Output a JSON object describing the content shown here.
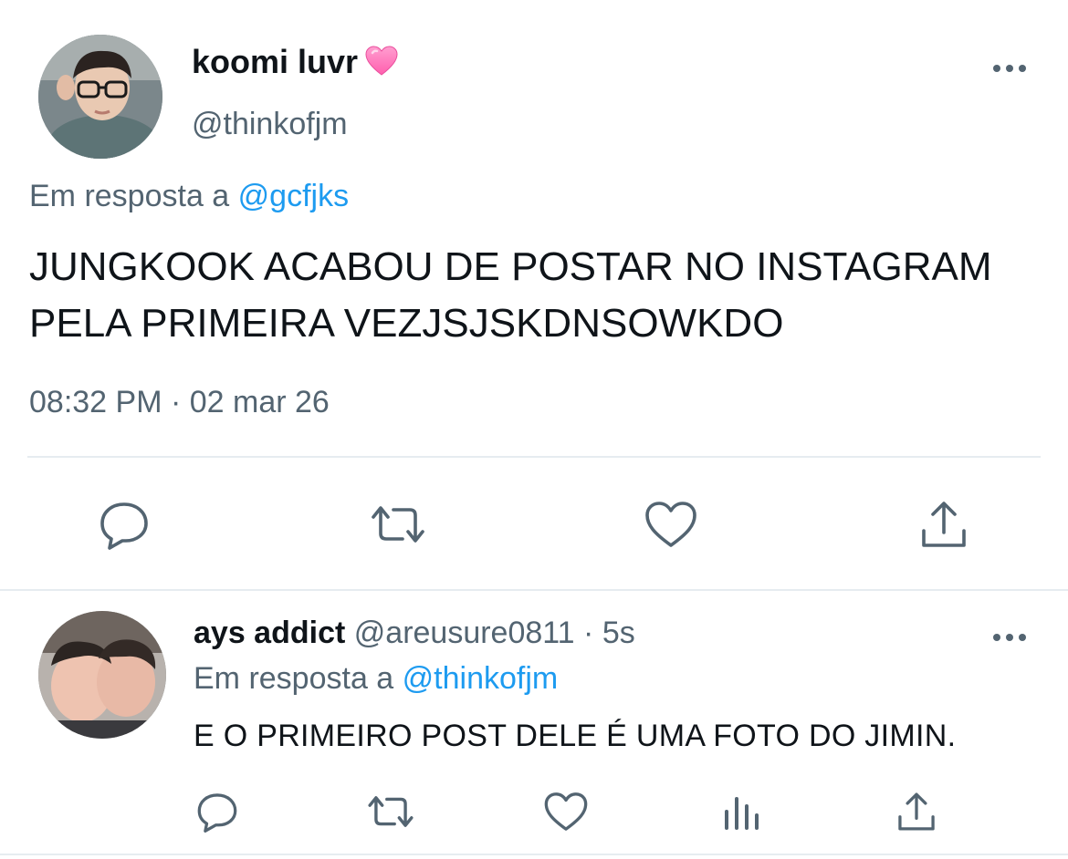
{
  "main_tweet": {
    "display_name": "koomi luvr",
    "name_emoji": "💗",
    "handle": "@thinkofjm",
    "reply_prefix": "Em resposta a",
    "reply_to": "@gcfjks",
    "text": "JUNGKOOK ACABOU DE POSTAR NO INSTAGRAM PELA PRIMEIRA VEZJSJSKDNSOWKDO",
    "timestamp": "08:32 PM · 02 mar 26",
    "actions": [
      "reply-icon",
      "retweet-icon",
      "like-icon",
      "share-icon"
    ]
  },
  "reply_tweet": {
    "display_name": "ays addict",
    "handle": "@areusure0811",
    "separator": "·",
    "age": "5s",
    "reply_prefix": "Em resposta a",
    "reply_to": "@thinkofjm",
    "text": "E O PRIMEIRO POST DELE É UMA FOTO DO JIMIN.",
    "actions": [
      "reply-icon",
      "retweet-icon",
      "like-icon",
      "analytics-icon",
      "share-icon"
    ]
  },
  "colors": {
    "text": "#0f1419",
    "secondary": "#536471",
    "link": "#1d9bf0",
    "divider": "#e6ecf0"
  }
}
